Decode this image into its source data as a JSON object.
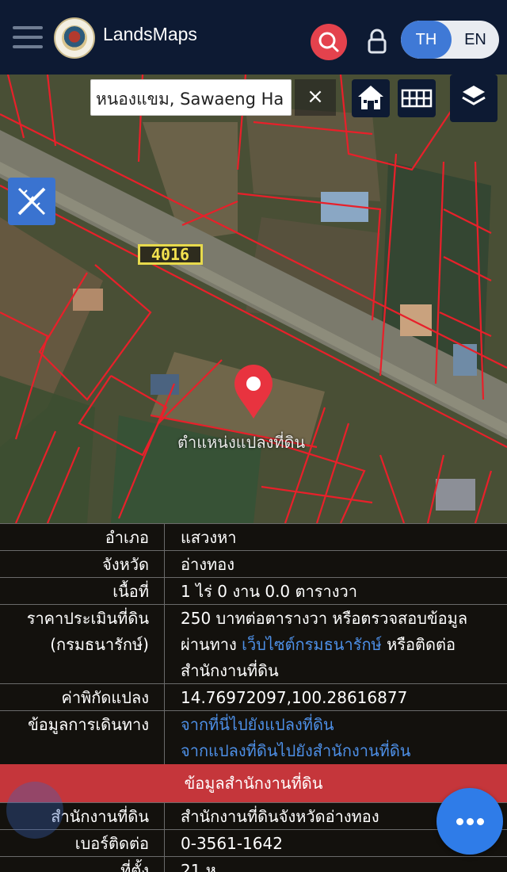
{
  "header": {
    "brand": "LandsMaps",
    "lang_th": "TH",
    "lang_en": "EN",
    "icons": [
      "menu-icon",
      "logo-emblem",
      "search-icon",
      "lock-icon"
    ]
  },
  "map": {
    "search_value": "หนองแขม, Sawaeng Ha",
    "clear_label": "×",
    "road_number": "4016",
    "parcel_label": "ตำแหน่งแปลงที่ดิน",
    "icons": [
      "home-icon",
      "grid-icon",
      "layers-icon",
      "ruler-pencil-icon",
      "location-pin-icon"
    ]
  },
  "info": {
    "rows": [
      {
        "key": "อำเภอ",
        "value": "แสวงหา"
      },
      {
        "key": "จังหวัด",
        "value": "อ่างทอง"
      },
      {
        "key": "เนื้อที่",
        "value": "1 ไร่ 0 งาน 0.0 ตารางวา"
      }
    ],
    "price": {
      "key_line1": "ราคาประเมินที่ดิน",
      "key_line2": "(กรมธนารักษ์)",
      "value_line1": "250 บาทต่อตารางวา หรือตรวจสอบข้อมูล",
      "value_line2_prefix": "ผ่านทาง ",
      "value_link": "เว็บไซต์กรมธนารักษ์",
      "value_line2_suffix": " หรือติดต่อ",
      "value_line3": "สำนักงานที่ดิน"
    },
    "coords": {
      "key": "ค่าพิกัดแปลง",
      "value": "14.76972097,100.28616877"
    },
    "travel": {
      "key": "ข้อมูลการเดินทาง",
      "link1": "จากที่นี่ไปยังแปลงที่ดิน",
      "link2": "จากแปลงที่ดินไปยังสำนักงานที่ดิน"
    },
    "section_title": "ข้อมูลสำนักงานที่ดิน",
    "office": {
      "key": "สำนักงานที่ดิน",
      "value": "สำนักงานที่ดินจังหวัดอ่างทอง"
    },
    "phone": {
      "key": "เบอร์ติดต่อ",
      "value": "0-3561-1642"
    },
    "partial": {
      "key": "ที่ตั้ง",
      "value": "21 ห"
    }
  },
  "colors": {
    "header_bg": "#0d1a33",
    "accent_blue": "#3f79d6",
    "search_red": "#e4424d",
    "section_red": "#c5363b",
    "parcel_line": "#e8202a",
    "link": "#4d8fe6"
  }
}
